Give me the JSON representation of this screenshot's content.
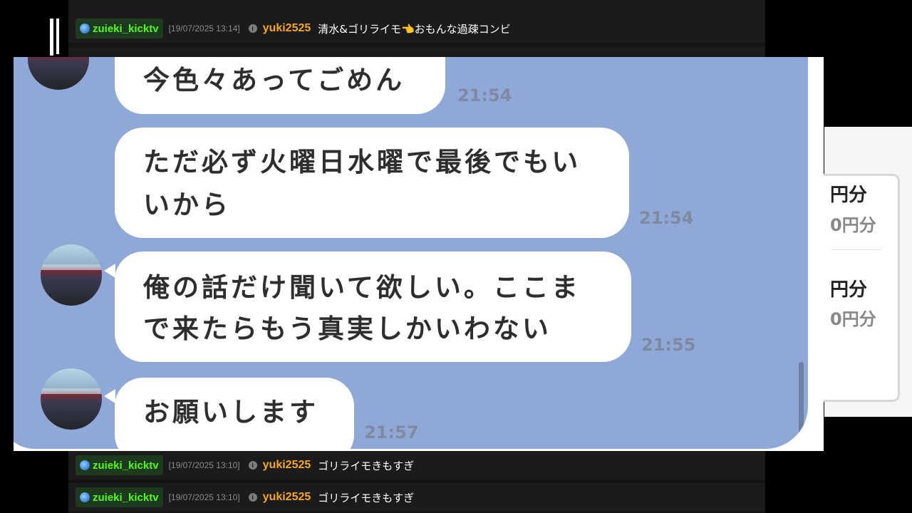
{
  "chat_log": {
    "rows": [
      {
        "channel": "zuieki_kicktv",
        "timestamp": "[19/07/2025 13:14]",
        "user": "yuki2525",
        "message": "清水&ゴリライモ👈おもんな過疎コンビ"
      },
      {
        "channel": "zuieki_kicktv",
        "timestamp": "[19/07/2025 13:10]",
        "user": "yuki2525",
        "message": "ゴリライモきもすぎ"
      },
      {
        "channel": "zuieki_kicktv",
        "timestamp": "[19/07/2025 13:10]",
        "user": "yuki2525",
        "message": "ゴリライモきもすぎ"
      }
    ]
  },
  "line_screenshot": {
    "messages": [
      {
        "lines": [
          "今色々あってごめん"
        ],
        "time": "21:54"
      },
      {
        "lines": [
          "ただ必ず火曜日水曜で最後でもい",
          "いから"
        ],
        "time": "21:54"
      },
      {
        "lines": [
          "俺の話だけ聞いて欲しい。ここま",
          "で来たらもう真実しかいわない"
        ],
        "time": "21:55"
      },
      {
        "lines": [
          "お願いします"
        ],
        "time": "21:57"
      }
    ]
  },
  "price_panel": {
    "prices": [
      "円分",
      "0円分",
      "円分",
      "0円分"
    ]
  },
  "colors": {
    "line_background": "#8fa8d6",
    "channel_green": "#53fc18",
    "username_orange": "#f5a623"
  }
}
